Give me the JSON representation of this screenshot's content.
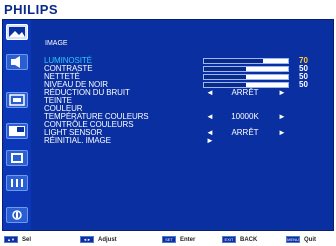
{
  "brand": "PHILIPS",
  "section_title": "IMAGE",
  "menu_rows": [
    {
      "label": "LUMINOSITÉ",
      "type": "bar",
      "value": 70,
      "highlight": true
    },
    {
      "label": "CONTRASTE",
      "type": "bar",
      "value": 50
    },
    {
      "label": "NETTETÉ",
      "type": "bar",
      "value": 50
    },
    {
      "label": "NIVEAU DE NOIR",
      "type": "bar",
      "value": 50
    },
    {
      "label": "RÉDUCTION DU BRUIT",
      "type": "select",
      "value": "ARRÊT",
      "left": "◄",
      "right": "►"
    },
    {
      "label": "TEINTE",
      "type": "text"
    },
    {
      "label": "COULEUR",
      "type": "text"
    },
    {
      "label": "TEMPÉRATURE COULEURS",
      "type": "select",
      "value": "10000K",
      "left": "◄",
      "right": "►"
    },
    {
      "label": "CONTRÔLE COULEURS",
      "type": "text"
    },
    {
      "label": "LIGHT SENSOR",
      "type": "select",
      "value": "ARRÊT",
      "left": "◄",
      "right": "►"
    },
    {
      "label": "RÉINITIAL. IMAGE",
      "type": "arrow",
      "left": "►"
    }
  ],
  "sidebar_icons": [
    "picture-icon",
    "audio-icon",
    "display-icon",
    "pip-icon",
    "monitor-icon",
    "settings-icon",
    "info-icon"
  ],
  "footer": {
    "sel": {
      "key": "▲▼",
      "label": "Sel"
    },
    "adjust": {
      "key": "◄►",
      "label": "Adjust"
    },
    "enter": {
      "key": "SET",
      "label": "Enter"
    },
    "back": {
      "key": "EXIT",
      "label": "BACK"
    },
    "quit": {
      "key": "MENU",
      "label": "Quit"
    }
  },
  "colors": {
    "panel": "#0a2fa0",
    "highlight": "#2bc8ff",
    "value_highlight": "#ffcc33"
  }
}
